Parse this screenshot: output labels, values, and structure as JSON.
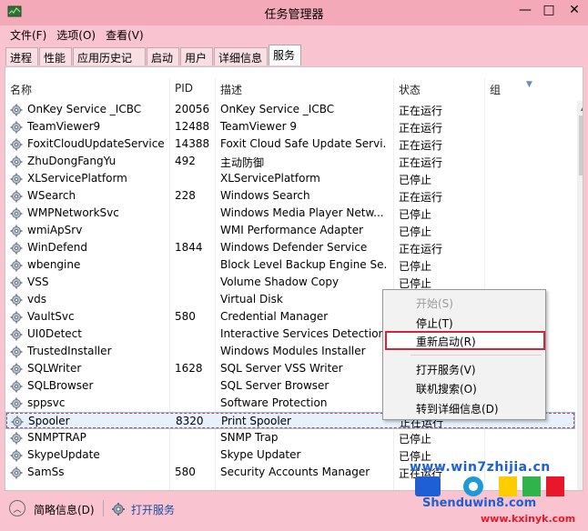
{
  "window": {
    "title": "任务管理器"
  },
  "title_buttons": {
    "minimize": "—",
    "maximize": "□",
    "close": "✕"
  },
  "menu": [
    "文件(F)",
    "选项(O)",
    "查看(V)"
  ],
  "tabs": [
    "进程",
    "性能",
    "应用历史记录",
    "启动",
    "用户",
    "详细信息",
    "服务"
  ],
  "active_tab": "服务",
  "columns": {
    "name": "名称",
    "pid": "PID",
    "desc": "描述",
    "status": "状态",
    "group": "组"
  },
  "services": [
    {
      "name": "OnKey Service _ICBC",
      "pid": "20056",
      "desc": "OnKey Service _ICBC",
      "status": "正在运行"
    },
    {
      "name": "TeamViewer9",
      "pid": "12488",
      "desc": "TeamViewer 9",
      "status": "正在运行"
    },
    {
      "name": "FoxitCloudUpdateService",
      "pid": "14388",
      "desc": "Foxit Cloud Safe Update Servi...",
      "status": "正在运行"
    },
    {
      "name": "ZhuDongFangYu",
      "pid": "492",
      "desc": "主动防御",
      "status": "正在运行"
    },
    {
      "name": "XLServicePlatform",
      "pid": "",
      "desc": "XLServicePlatform",
      "status": "已停止"
    },
    {
      "name": "WSearch",
      "pid": "228",
      "desc": "Windows Search",
      "status": "正在运行"
    },
    {
      "name": "WMPNetworkSvc",
      "pid": "",
      "desc": "Windows Media Player Netw...",
      "status": "已停止"
    },
    {
      "name": "wmiApSrv",
      "pid": "",
      "desc": "WMI Performance Adapter",
      "status": "已停止"
    },
    {
      "name": "WinDefend",
      "pid": "1844",
      "desc": "Windows Defender Service",
      "status": "正在运行"
    },
    {
      "name": "wbengine",
      "pid": "",
      "desc": "Block Level Backup Engine Se...",
      "status": "已停止"
    },
    {
      "name": "VSS",
      "pid": "",
      "desc": "Volume Shadow Copy",
      "status": "已停止"
    },
    {
      "name": "vds",
      "pid": "",
      "desc": "Virtual Disk",
      "status": ""
    },
    {
      "name": "VaultSvc",
      "pid": "580",
      "desc": "Credential Manager",
      "status": ""
    },
    {
      "name": "UI0Detect",
      "pid": "",
      "desc": "Interactive Services Detection",
      "status": ""
    },
    {
      "name": "TrustedInstaller",
      "pid": "",
      "desc": "Windows Modules Installer",
      "status": ""
    },
    {
      "name": "SQLWriter",
      "pid": "1628",
      "desc": "SQL Server VSS Writer",
      "status": ""
    },
    {
      "name": "SQLBrowser",
      "pid": "",
      "desc": "SQL Server Browser",
      "status": ""
    },
    {
      "name": "sppsvc",
      "pid": "",
      "desc": "Software Protection",
      "status": ""
    },
    {
      "name": "Spooler",
      "pid": "8320",
      "desc": "Print Spooler",
      "status": "正在运行"
    },
    {
      "name": "SNMPTRAP",
      "pid": "",
      "desc": "SNMP Trap",
      "status": "已停止"
    },
    {
      "name": "SkypeUpdate",
      "pid": "",
      "desc": "Skype Updater",
      "status": "已停止"
    },
    {
      "name": "SamSs",
      "pid": "580",
      "desc": "Security Accounts Manager",
      "status": "正在运行"
    }
  ],
  "selected_service": "Spooler",
  "context_menu": {
    "start": "开始(S)",
    "stop": "停止(T)",
    "restart": "重新启动(R)",
    "open_services": "打开服务(V)",
    "search_online": "联机搜索(O)",
    "go_to_details": "转到详细信息(D)"
  },
  "footer": {
    "fewer_details": "简略信息(D)",
    "open_services": "打开服务"
  },
  "watermark": {
    "line1": "www.win7zhijia.cn",
    "line2": "Shenduwin8.com",
    "line3": "www.kxinyk.com"
  },
  "colors": {
    "title_bar": "#f4a9b8",
    "window_frame": "#f9c3cf",
    "highlight_box": "#d0263a",
    "selection": "#e6f1fb",
    "link": "#1a4fa3"
  }
}
